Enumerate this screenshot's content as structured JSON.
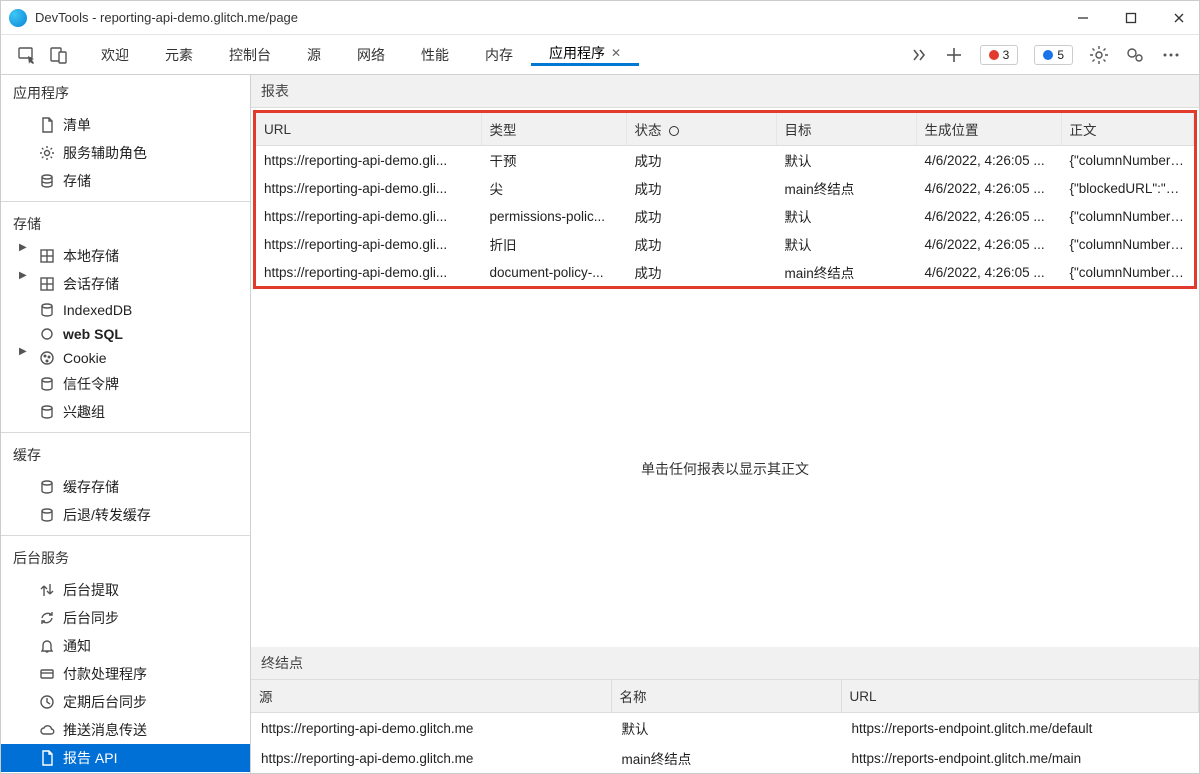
{
  "window": {
    "title": "DevTools - reporting-api-demo.glitch.me/page"
  },
  "tabs": {
    "items": [
      {
        "label": "欢迎"
      },
      {
        "label": "元素"
      },
      {
        "label": "控制台"
      },
      {
        "label": "源"
      },
      {
        "label": "网络"
      },
      {
        "label": "性能"
      },
      {
        "label": "内存"
      },
      {
        "label": "应用程序",
        "active": true,
        "closable": true
      }
    ],
    "errors_count": "3",
    "info_count": "5"
  },
  "sidebar": {
    "app_section": "应用程序",
    "app_items": [
      {
        "label": "清单",
        "icon": "file"
      },
      {
        "label": "服务辅助角色",
        "icon": "gear"
      },
      {
        "label": "存储",
        "icon": "db"
      }
    ],
    "storage_section": "存储",
    "storage_items": [
      {
        "label": "本地存储",
        "icon": "grid",
        "expandable": true
      },
      {
        "label": "会话存储",
        "icon": "grid",
        "expandable": true
      },
      {
        "label": "IndexedDB",
        "icon": "db"
      },
      {
        "label": "web SQL",
        "icon": "circle",
        "bold": true
      },
      {
        "label": "Cookie",
        "icon": "cookie",
        "expandable": true
      },
      {
        "label": "信任令牌",
        "icon": "db"
      },
      {
        "label": "兴趣组",
        "icon": "db"
      }
    ],
    "cache_section": "缓存",
    "cache_items": [
      {
        "label": "缓存存储",
        "icon": "db"
      },
      {
        "label": "后退/转发缓存",
        "icon": "db"
      }
    ],
    "bg_section": "后台服务",
    "bg_items": [
      {
        "label": "后台提取",
        "icon": "updown"
      },
      {
        "label": "后台同步",
        "icon": "sync"
      },
      {
        "label": "通知",
        "icon": "bell"
      },
      {
        "label": "付款处理程序",
        "icon": "card"
      },
      {
        "label": "定期后台同步",
        "icon": "clock"
      },
      {
        "label": "推送消息传送",
        "icon": "cloud"
      },
      {
        "label": "报告 API",
        "icon": "file",
        "selected": true
      }
    ]
  },
  "reports": {
    "heading": "报表",
    "columns": {
      "url": "URL",
      "type": "类型",
      "status": "状态",
      "dest": "目标",
      "gen": "生成位置",
      "body": "正文"
    },
    "rows": [
      {
        "url": "https://reporting-api-demo.gli...",
        "type": "干预",
        "status": "成功",
        "dest": "默认",
        "gen": "4/6/2022, 4:26:05 ...",
        "body": "{\"columnNumber\"..."
      },
      {
        "url": "https://reporting-api-demo.gli...",
        "type": "尖",
        "status": "成功",
        "dest": "main终结点",
        "gen": "4/6/2022, 4:26:05 ...",
        "body": "{\"blockedURL\":\"htt..."
      },
      {
        "url": "https://reporting-api-demo.gli...",
        "type": "permissions-polic...",
        "status": "成功",
        "dest": "默认",
        "gen": "4/6/2022, 4:26:05 ...",
        "body": "{\"columnNumber\"..."
      },
      {
        "url": "https://reporting-api-demo.gli...",
        "type": "折旧",
        "status": "成功",
        "dest": "默认",
        "gen": "4/6/2022, 4:26:05 ...",
        "body": "{\"columnNumber\"..."
      },
      {
        "url": "https://reporting-api-demo.gli...",
        "type": "document-policy-...",
        "status": "成功",
        "dest": "main终结点",
        "gen": "4/6/2022, 4:26:05 ...",
        "body": "{\"columnNumber\"..."
      }
    ],
    "placeholder": "单击任何报表以显示其正文"
  },
  "endpoints": {
    "heading": "终结点",
    "columns": {
      "origin": "源",
      "name": "名称",
      "url": "URL"
    },
    "rows": [
      {
        "origin": "https://reporting-api-demo.glitch.me",
        "name": "默认",
        "url": "https://reports-endpoint.glitch.me/default"
      },
      {
        "origin": "https://reporting-api-demo.glitch.me",
        "name": "main终结点",
        "url": "https://reports-endpoint.glitch.me/main"
      }
    ]
  }
}
